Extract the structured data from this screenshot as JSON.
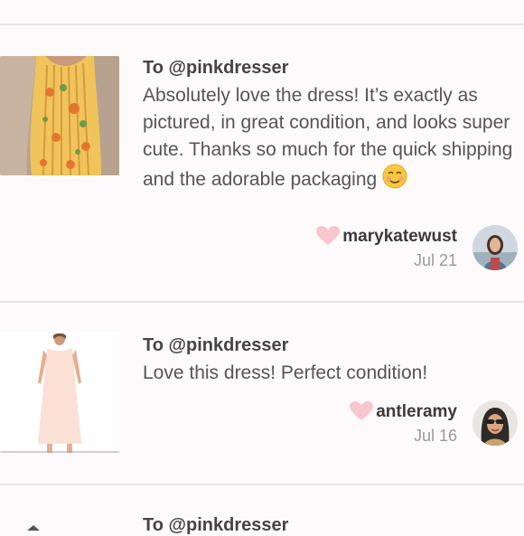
{
  "reviews": [
    {
      "recipient": "To @pinkdresser",
      "text": "Absolutely love the dress! It’s exactly as pictured, in great condition, and looks super cute. Thanks so much for the quick shipping and the adorable packaging",
      "emoji": "smiling-face-icon",
      "username": "marykatewust",
      "date": "Jul 21"
    },
    {
      "recipient": "To @pinkdresser",
      "text": "Love this dress! Perfect condition!",
      "username": "antleramy",
      "date": "Jul 16"
    },
    {
      "recipient": "To @pinkdresser"
    }
  ],
  "colors": {
    "heart": "#f8c6cd",
    "background": "#fdfafb",
    "divider": "#e6e3e4"
  }
}
